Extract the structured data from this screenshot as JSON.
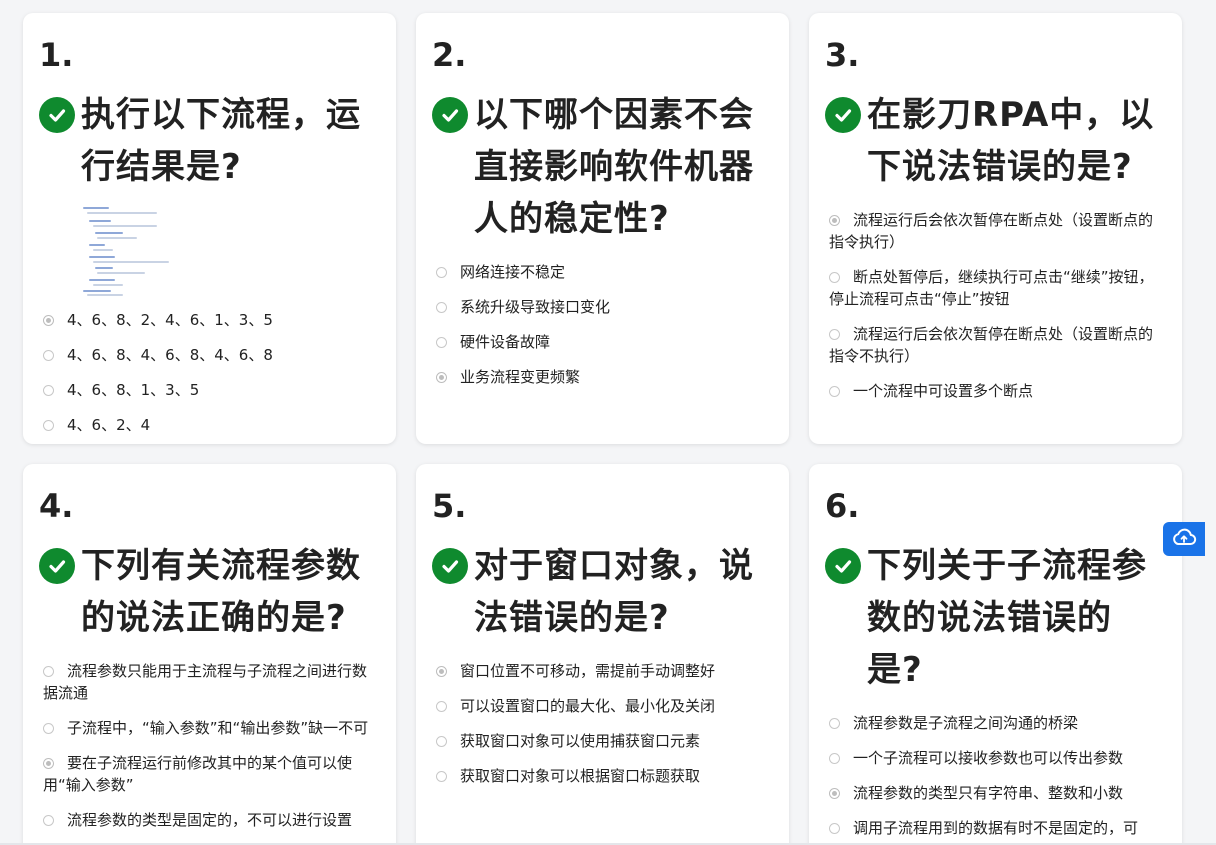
{
  "questions": [
    {
      "number": "1.",
      "title": "执行以下流程，运行结果是?",
      "options": [
        {
          "label": "4、6、8、2、4、6、1、3、5",
          "selected": true
        },
        {
          "label": "4、6、8、4、6、8、4、6、8",
          "selected": false
        },
        {
          "label": "4、6、8、1、3、5",
          "selected": false
        },
        {
          "label": "4、6、2、4",
          "selected": false
        }
      ]
    },
    {
      "number": "2.",
      "title": "以下哪个因素不会直接影响软件机器人的稳定性?",
      "options": [
        {
          "label": "网络连接不稳定",
          "selected": false
        },
        {
          "label": "系统升级导致接口变化",
          "selected": false
        },
        {
          "label": "硬件设备故障",
          "selected": false
        },
        {
          "label": "业务流程变更频繁",
          "selected": true
        }
      ]
    },
    {
      "number": "3.",
      "title": "在影刀RPA中，以下说法错误的是?",
      "options": [
        {
          "label": "流程运行后会依次暂停在断点处（设置断点的指令执行）",
          "selected": true
        },
        {
          "label": "断点处暂停后，继续执行可点击“继续”按钮，停止流程可点击“停止”按钮",
          "selected": false
        },
        {
          "label": "流程运行后会依次暂停在断点处（设置断点的指令不执行）",
          "selected": false
        },
        {
          "label": "一个流程中可设置多个断点",
          "selected": false
        }
      ]
    },
    {
      "number": "4.",
      "title": "下列有关流程参数的说法正确的是?",
      "options": [
        {
          "label": "流程参数只能用于主流程与子流程之间进行数据流通",
          "selected": false
        },
        {
          "label": "子流程中，“输入参数”和“输出参数”缺一不可",
          "selected": false
        },
        {
          "label": "要在子流程运行前修改其中的某个值可以使用“输入参数”",
          "selected": true
        },
        {
          "label": "流程参数的类型是固定的，不可以进行设置",
          "selected": false
        }
      ]
    },
    {
      "number": "5.",
      "title": "对于窗口对象，说法错误的是?",
      "options": [
        {
          "label": "窗口位置不可移动，需提前手动调整好",
          "selected": true
        },
        {
          "label": "可以设置窗口的最大化、最小化及关闭",
          "selected": false
        },
        {
          "label": "获取窗口对象可以使用捕获窗口元素",
          "selected": false
        },
        {
          "label": "获取窗口对象可以根据窗口标题获取",
          "selected": false
        }
      ]
    },
    {
      "number": "6.",
      "title": "下列关于子流程参数的说法错误的是?",
      "options": [
        {
          "label": "流程参数是子流程之间沟通的桥梁",
          "selected": false
        },
        {
          "label": "一个子流程可以接收参数也可以传出参数",
          "selected": false
        },
        {
          "label": "流程参数的类型只有字符串、整数和小数",
          "selected": true
        },
        {
          "label": "调用子流程用到的数据有时不是固定的，可",
          "selected": false
        }
      ]
    }
  ],
  "icons": {
    "check": "check-circle-icon",
    "cloud": "cloud-upload-icon"
  },
  "colors": {
    "check_green": "#0f8a2e",
    "cloud_blue": "#1a73e8"
  }
}
